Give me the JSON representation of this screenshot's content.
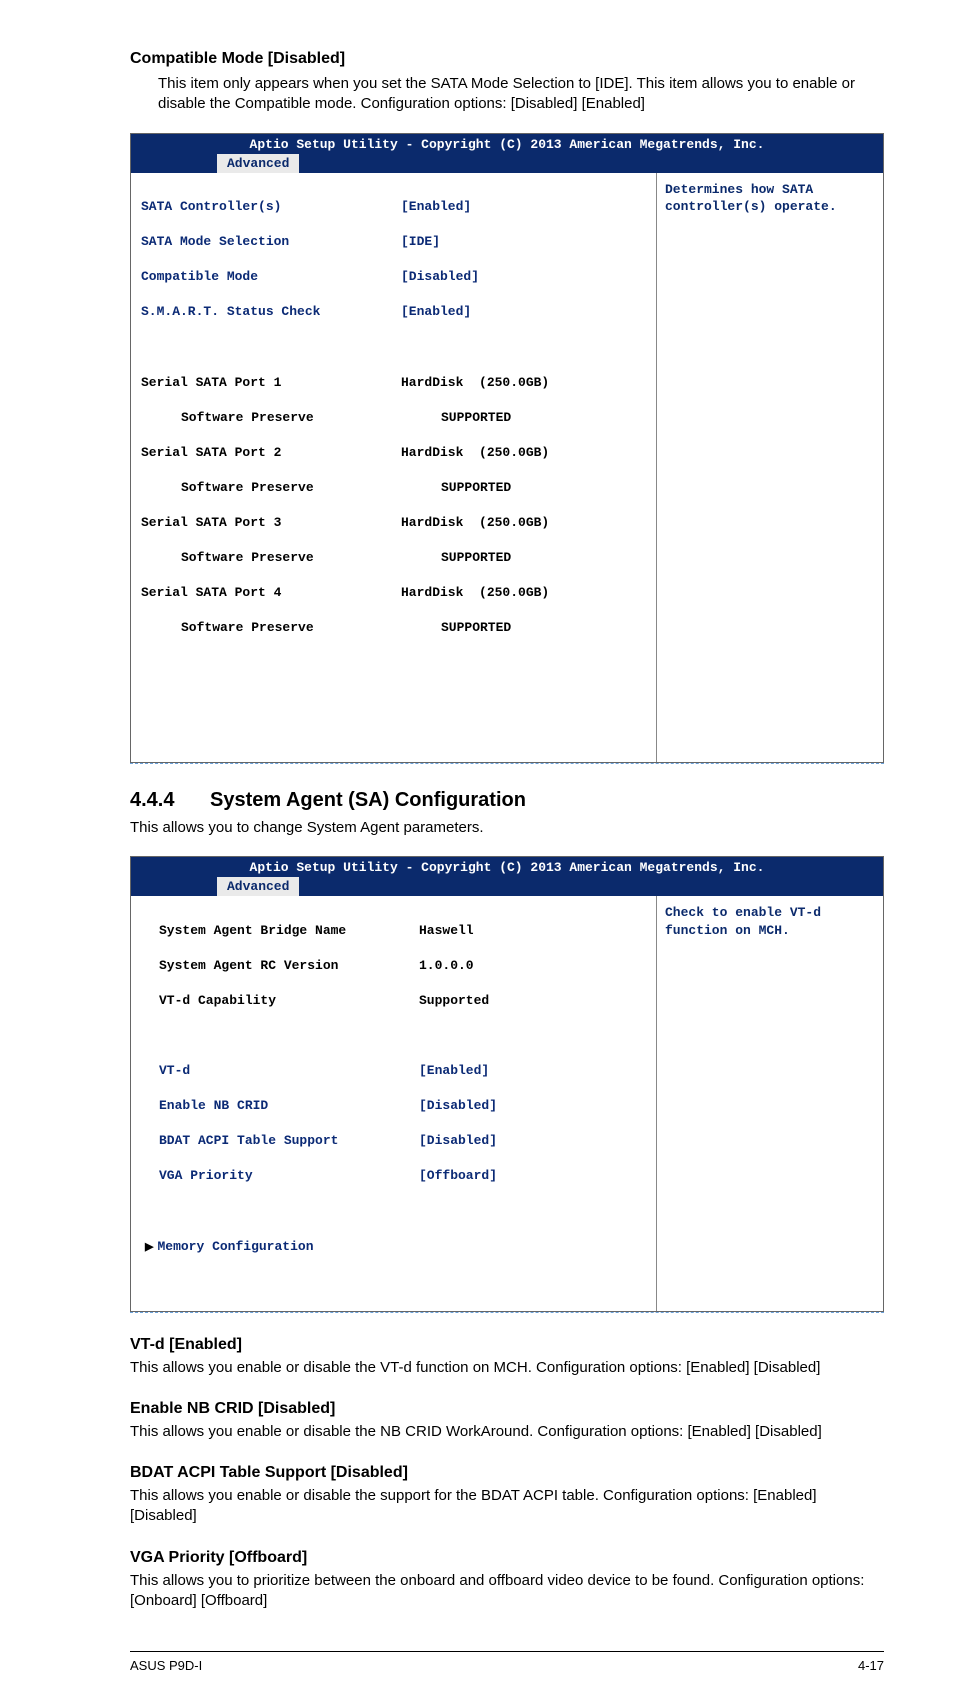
{
  "compat": {
    "head": "Compatible Mode [Disabled]",
    "body": "This item only appears when you set the SATA Mode Selection to [IDE]. This item allows you to enable or disable the Compatible mode. Configuration options: [Disabled] [Enabled]"
  },
  "bios1": {
    "title": "Aptio Setup Utility - Copyright (C) 2013 American Megatrends, Inc.",
    "tab": "Advanced",
    "rows": {
      "sata_ctrl_l": "SATA Controller(s)",
      "sata_ctrl_v": "[Enabled]",
      "sata_mode_l": "SATA Mode Selection",
      "sata_mode_v": "[IDE]",
      "compat_l": "Compatible Mode",
      "compat_v": "[Disabled]",
      "smart_l": "S.M.A.R.T. Status Check",
      "smart_v": "[Enabled]",
      "p1_l": "Serial SATA Port 1",
      "p1_v": "HardDisk  (250.0GB)",
      "p1s_l": "Software Preserve",
      "p1s_v": "SUPPORTED",
      "p2_l": "Serial SATA Port 2",
      "p2_v": "HardDisk  (250.0GB)",
      "p2s_l": "Software Preserve",
      "p2s_v": "SUPPORTED",
      "p3_l": "Serial SATA Port 3",
      "p3_v": "HardDisk  (250.0GB)",
      "p3s_l": "Software Preserve",
      "p3s_v": "SUPPORTED",
      "p4_l": "Serial SATA Port 4",
      "p4_v": "HardDisk  (250.0GB)",
      "p4s_l": "Software Preserve",
      "p4s_v": "SUPPORTED"
    },
    "help": "Determines how SATA controller(s) operate."
  },
  "sec44": {
    "num": "4.4.4",
    "title": "System Agent (SA) Configuration",
    "desc": "This allows you to change System Agent parameters."
  },
  "bios2": {
    "title": "Aptio Setup Utility - Copyright (C) 2013 American Megatrends, Inc.",
    "tab": "Advanced",
    "rows": {
      "bridge_l": "System Agent Bridge Name",
      "bridge_v": "Haswell",
      "rc_l": "System Agent RC Version",
      "rc_v": "1.0.0.0",
      "vtdcap_l": "VT-d Capability",
      "vtdcap_v": "Supported",
      "vtd_l": "VT-d",
      "vtd_v": "[Enabled]",
      "nbcrid_l": "Enable NB CRID",
      "nbcrid_v": "[Disabled]",
      "bdat_l": "BDAT ACPI Table Support",
      "bdat_v": "[Disabled]",
      "vga_l": "VGA Priority",
      "vga_v": "[Offboard]",
      "mem_l": "Memory Configuration"
    },
    "help": "Check to enable VT-d function on MCH."
  },
  "vtd": {
    "head": "VT-d [Enabled]",
    "body": "This allows you enable or disable the VT-d function on MCH. Configuration options: [Enabled] [Disabled]"
  },
  "nbcrid": {
    "head": "Enable NB CRID [Disabled]",
    "body": "This allows you enable or disable the NB CRID WorkAround. Configuration options: [Enabled] [Disabled]"
  },
  "bdat": {
    "head": "BDAT ACPI Table Support [Disabled]",
    "body": "This allows you enable or disable the support for the BDAT ACPI table. Configuration options: [Enabled] [Disabled]"
  },
  "vga": {
    "head": "VGA Priority [Offboard]",
    "body": "This allows you to prioritize between the onboard and offboard video device to be found. Configuration options: [Onboard] [Offboard]"
  },
  "footer": {
    "left": "ASUS P9D-I",
    "right": "4-17"
  }
}
